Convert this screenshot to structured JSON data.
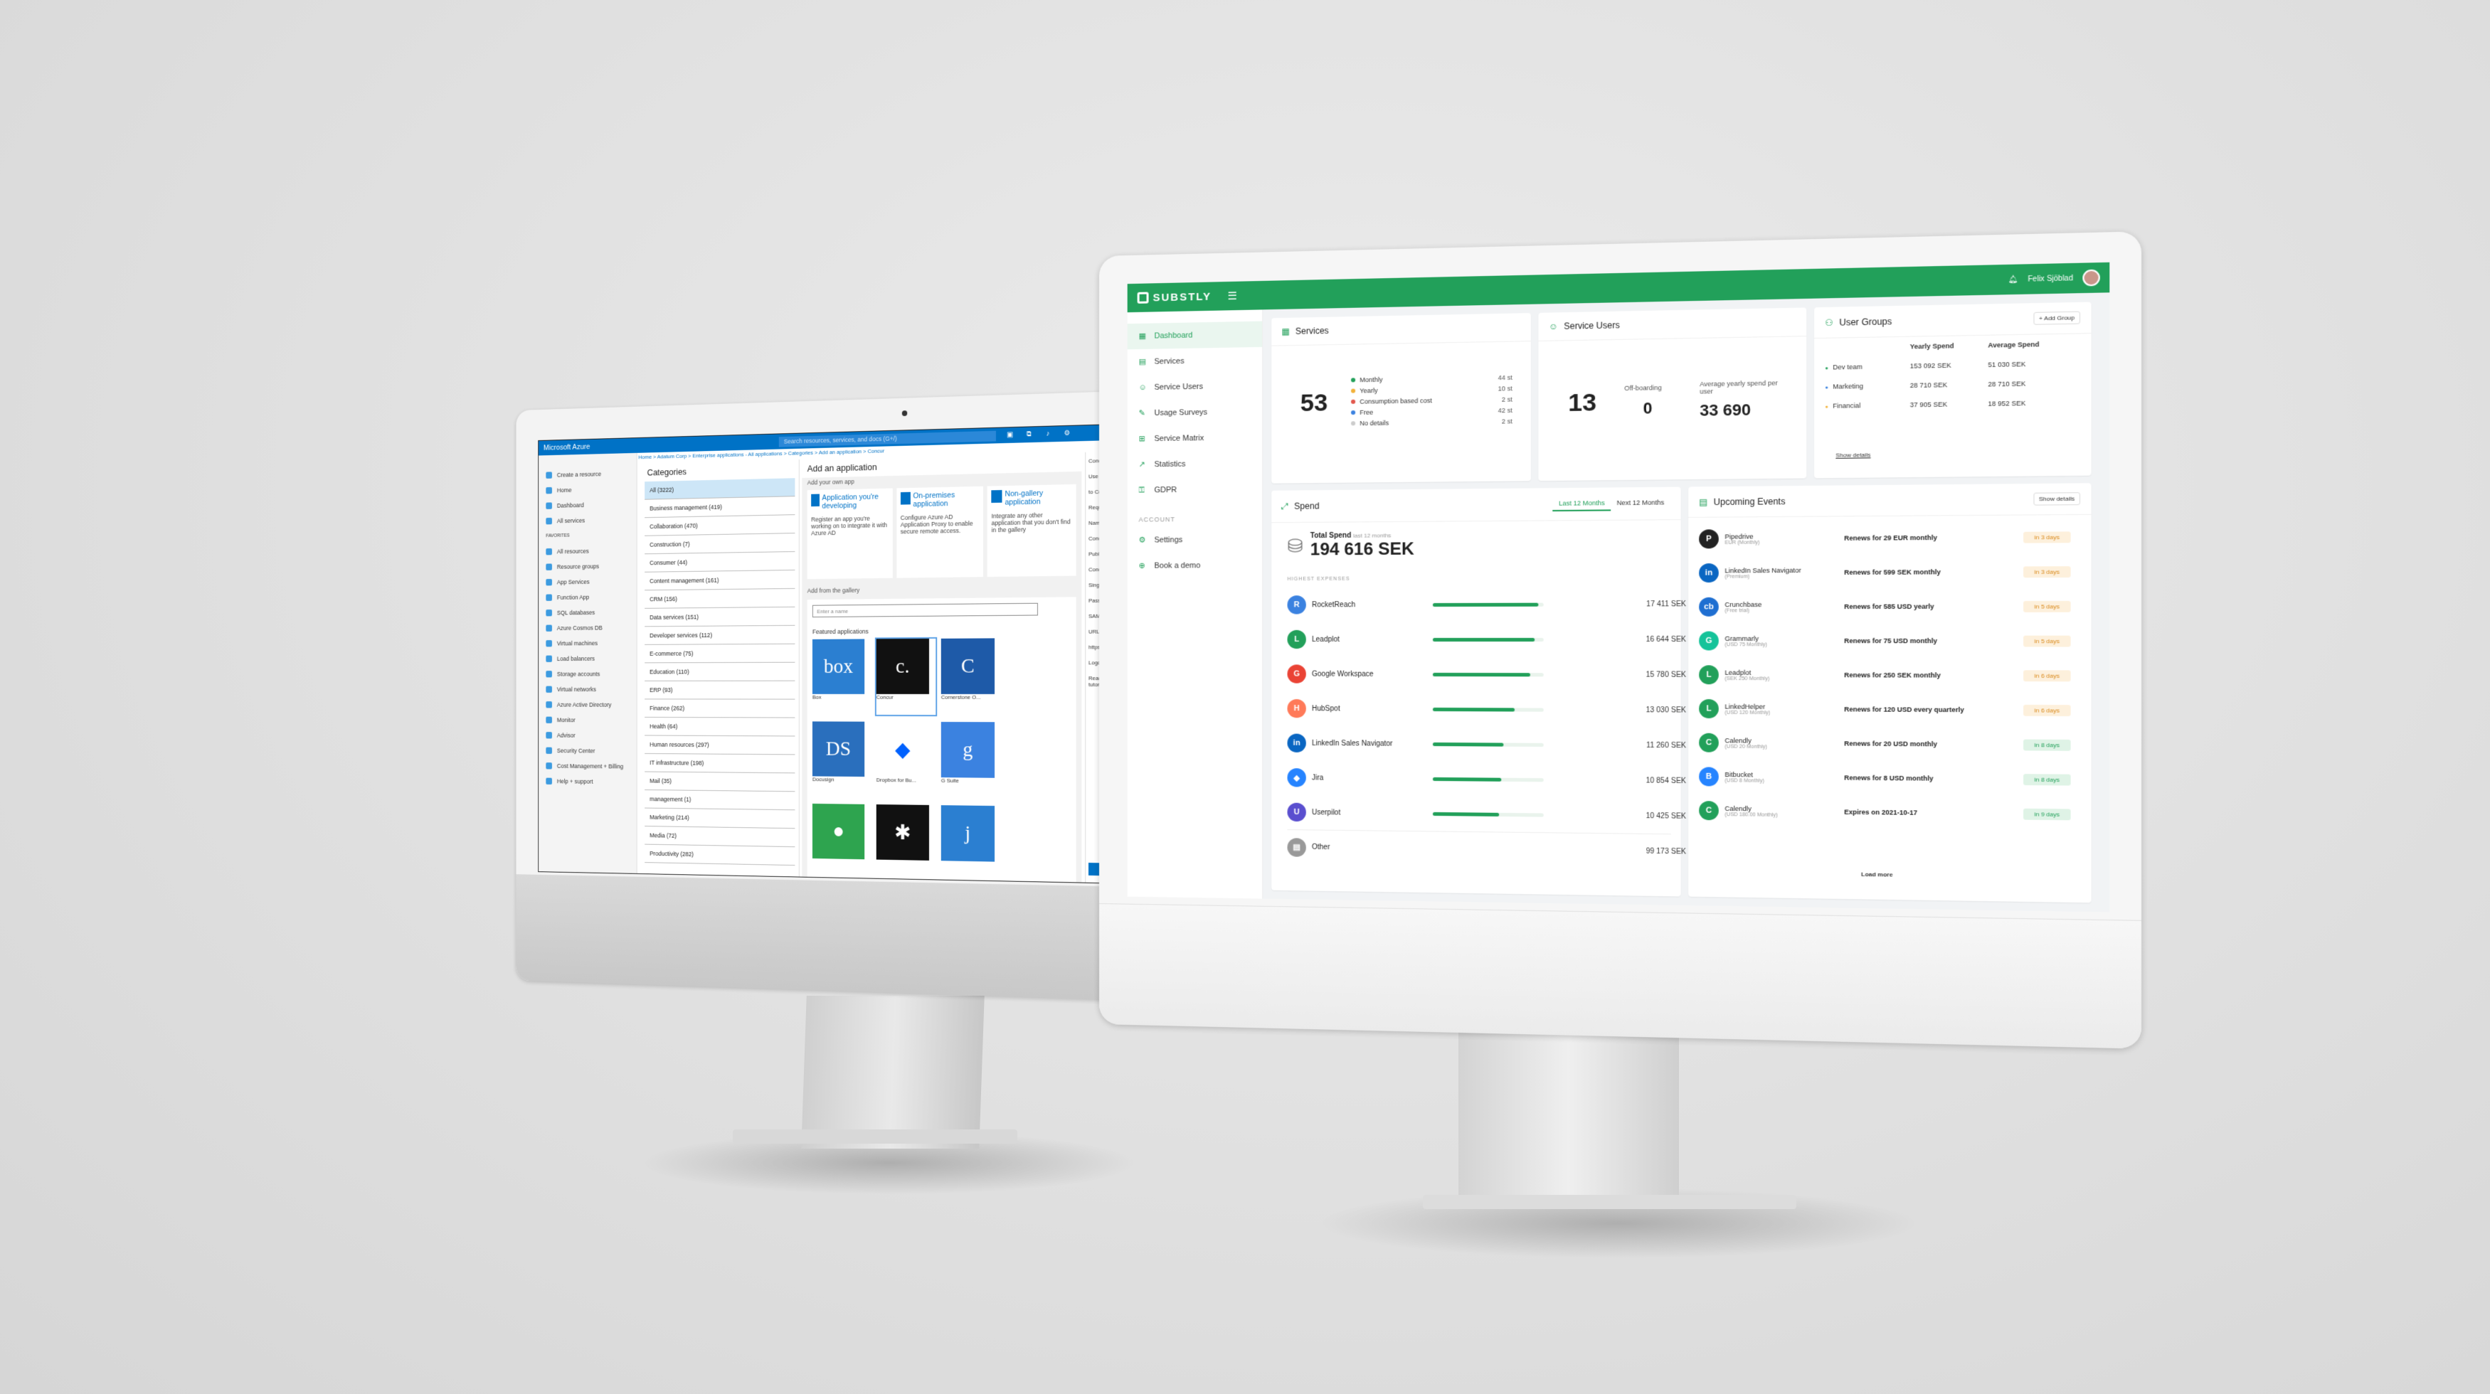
{
  "azure": {
    "brand": "Microsoft Azure",
    "search_placeholder": "Search resources, services, and docs (G+/)",
    "breadcrumb": "Home  >  Adatum Corp  >  Enterprise applications - All applications  >  Categories  >  Add an application  >  Concur",
    "sidebar": [
      "Create a resource",
      "Home",
      "Dashboard",
      "All services",
      "FAVORITES",
      "All resources",
      "Resource groups",
      "App Services",
      "Function App",
      "SQL databases",
      "Azure Cosmos DB",
      "Virtual machines",
      "Load balancers",
      "Storage accounts",
      "Virtual networks",
      "Azure Active Directory",
      "Monitor",
      "Advisor",
      "Security Center",
      "Cost Management + Billing",
      "Help + support"
    ],
    "categories_title": "Categories",
    "categories": [
      "All (3222)",
      "Business management (419)",
      "Collaboration (470)",
      "Construction (7)",
      "Consumer (44)",
      "Content management (161)",
      "CRM (156)",
      "Data services (151)",
      "Developer services (112)",
      "E-commerce (75)",
      "Education (110)",
      "ERP (93)",
      "Finance (262)",
      "Health (64)",
      "Human resources (297)",
      "IT infrastructure (198)",
      "Mail (35)",
      "management (1)",
      "Marketing (214)",
      "Media (72)",
      "Productivity (282)"
    ],
    "add_title": "Add an application",
    "own_app_label": "Add your own app",
    "options": [
      {
        "title": "Application you're developing",
        "desc": "Register an app you're working on to integrate it with Azure AD"
      },
      {
        "title": "On-premises application",
        "desc": "Configure Azure AD Application Proxy to enable secure remote access."
      },
      {
        "title": "Non-gallery application",
        "desc": "Integrate any other application that you don't find in the gallery"
      }
    ],
    "gallery_label": "Add from the gallery",
    "gallery_input_placeholder": "Enter a name",
    "featured_label": "Featured applications",
    "tiles": [
      {
        "name": "Box",
        "glyph": "box",
        "color": "#2b7fd1"
      },
      {
        "name": "Concur",
        "glyph": "c.",
        "color": "#111111"
      },
      {
        "name": "Cornerstone O...",
        "glyph": "C",
        "color": "#1e5aa8"
      },
      {
        "name": "Docusign",
        "glyph": "DS",
        "color": "#2a6fbd"
      },
      {
        "name": "Dropbox for Bu...",
        "glyph": "◆",
        "color": "#ffffff"
      },
      {
        "name": "G Suite",
        "glyph": "g",
        "color": "#3b82e0"
      },
      {
        "name": "",
        "glyph": "●",
        "color": "#2ea44f"
      },
      {
        "name": "",
        "glyph": "✱",
        "color": "#111111"
      },
      {
        "name": "",
        "glyph": "j",
        "color": "#2b7fd1"
      }
    ],
    "right_panel": [
      "Conc...",
      "Use N...",
      "to Co...",
      "Requi...",
      "Name",
      "Concur",
      "Publish",
      "Concur",
      "Single S...",
      "Passwo...",
      "SAML-ba...",
      "URL",
      "https://w...",
      "Logo",
      "Read our ste... tutorial"
    ],
    "add_button": "Add"
  },
  "substly": {
    "brand": "SUBSTLY",
    "user_name": "Felix Sjöblad",
    "nav": [
      "Dashboard",
      "Services",
      "Service Users",
      "Usage Surveys",
      "Service Matrix",
      "Statistics",
      "GDPR"
    ],
    "account_label": "ACCOUNT",
    "account_nav": [
      "Settings",
      "Book a demo"
    ],
    "services": {
      "title": "Services",
      "total": "53",
      "legend": [
        {
          "label": "Monthly",
          "value": "44",
          "color": "#22a05a"
        },
        {
          "label": "Yearly",
          "value": "10",
          "color": "#f2b23a"
        },
        {
          "label": "Consumption based cost",
          "value": "2",
          "color": "#e2574c"
        },
        {
          "label": "Free",
          "value": "42",
          "color": "#3b82e0"
        },
        {
          "label": "No details",
          "value": "2",
          "color": "#cccccc"
        }
      ],
      "unit": "st"
    },
    "service_users": {
      "title": "Service Users",
      "total": "13",
      "offboarding_label": "Off-boarding",
      "offboarding": "0",
      "avg_label": "Average yearly spend per user",
      "avg": "33 690"
    },
    "user_groups": {
      "title": "User Groups",
      "add_label": "+ Add Group",
      "col_yearly": "Yearly Spend",
      "col_avg": "Average Spend",
      "rows": [
        {
          "name": "Dev team",
          "yearly": "153 092 SEK",
          "avg": "51 030 SEK",
          "color": "#22a05a"
        },
        {
          "name": "Marketing",
          "yearly": "28 710 SEK",
          "avg": "28 710 SEK",
          "color": "#3b82e0"
        },
        {
          "name": "Financial",
          "yearly": "37 905 SEK",
          "avg": "18 952 SEK",
          "color": "#f2b23a"
        }
      ],
      "show_details": "Show details"
    },
    "spend": {
      "title": "Spend",
      "tab_last": "Last 12 Months",
      "tab_next": "Next 12 Months",
      "total_label": "Total Spend",
      "total_sub": "last 12 months",
      "total": "194 616 SEK",
      "highest_label": "HIGHEST EXPENSES",
      "rows": [
        {
          "name": "RocketReach",
          "value": "17 411 SEK",
          "frac": 0.95,
          "color": "#3b82e0",
          "glyph": "R"
        },
        {
          "name": "Leadplot",
          "value": "16 644 SEK",
          "frac": 0.92,
          "color": "#22a05a",
          "glyph": "L"
        },
        {
          "name": "Google Workspace",
          "value": "15 780 SEK",
          "frac": 0.88,
          "color": "#ea4335",
          "glyph": "G"
        },
        {
          "name": "HubSpot",
          "value": "13 030 SEK",
          "frac": 0.74,
          "color": "#ff7a59",
          "glyph": "H"
        },
        {
          "name": "LinkedIn Sales Navigator",
          "value": "11 260 SEK",
          "frac": 0.64,
          "color": "#0a66c2",
          "glyph": "in"
        },
        {
          "name": "Jira",
          "value": "10 854 SEK",
          "frac": 0.62,
          "color": "#2684ff",
          "glyph": "◆"
        },
        {
          "name": "Userpilot",
          "value": "10 425 SEK",
          "frac": 0.6,
          "color": "#5a4fcf",
          "glyph": "U"
        },
        {
          "name": "Other",
          "value": "99 173 SEK",
          "frac": 0,
          "color": "#999999",
          "glyph": "▤"
        }
      ]
    },
    "events": {
      "title": "Upcoming Events",
      "show_details": "Show details",
      "rows": [
        {
          "name": "Pipedrive",
          "sub": "EUR (Monthly)",
          "text": "Renews for 29 EUR monthly",
          "badge": "in 3 days",
          "kind": "o",
          "color": "#222222",
          "glyph": "P"
        },
        {
          "name": "LinkedIn Sales Navigator",
          "sub": "(Premium)",
          "text": "Renews for 599 SEK monthly",
          "badge": "in 3 days",
          "kind": "o",
          "color": "#0a66c2",
          "glyph": "in"
        },
        {
          "name": "Crunchbase",
          "sub": "(Free trial)",
          "text": "Renews for 585 USD yearly",
          "badge": "in 5 days",
          "kind": "o",
          "color": "#1f6fd1",
          "glyph": "cb"
        },
        {
          "name": "Grammarly",
          "sub": "(USD 75 Monthly)",
          "text": "Renews for 75 USD monthly",
          "badge": "in 5 days",
          "kind": "o",
          "color": "#15c39a",
          "glyph": "G"
        },
        {
          "name": "Leadplot",
          "sub": "(SEK 250 Monthly)",
          "text": "Renews for 250 SEK monthly",
          "badge": "in 6 days",
          "kind": "o",
          "color": "#22a05a",
          "glyph": "L"
        },
        {
          "name": "LinkedHelper",
          "sub": "(USD 120 Monthly)",
          "text": "Renews for 120 USD every quarterly",
          "badge": "in 6 days",
          "kind": "o",
          "color": "#22a05a",
          "glyph": "L"
        },
        {
          "name": "Calendly",
          "sub": "(USD 20 Monthly)",
          "text": "Renews for 20 USD monthly",
          "badge": "in 8 days",
          "kind": "g",
          "color": "#22a05a",
          "glyph": "C"
        },
        {
          "name": "Bitbucket",
          "sub": "(USD 8 Monthly)",
          "text": "Renews for 8 USD monthly",
          "badge": "in 8 days",
          "kind": "g",
          "color": "#2684ff",
          "glyph": "B"
        },
        {
          "name": "Calendly",
          "sub": "(USD 180.00 Monthly)",
          "text": "Expires on 2021-10-17",
          "badge": "in 9 days",
          "kind": "g",
          "color": "#22a05a",
          "glyph": "C"
        }
      ],
      "load_more": "Load more"
    }
  }
}
